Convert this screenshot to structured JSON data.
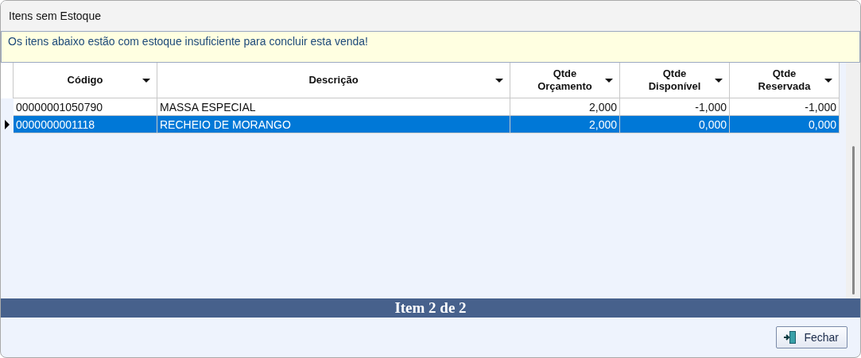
{
  "window": {
    "title": "Itens sem Estoque"
  },
  "banner": "Os itens abaixo estão com estoque insuficiente para concluir esta venda!",
  "table": {
    "columns": [
      {
        "label": "Código"
      },
      {
        "label": "Descrição"
      },
      {
        "label": "Qtde\nOrçamento"
      },
      {
        "label": "Qtde\nDisponível"
      },
      {
        "label": "Qtde\nReservada"
      }
    ],
    "rows": [
      {
        "selected": false,
        "cells": [
          "00000001050790",
          "MASSA ESPECIAL",
          "2,000",
          "-1,000",
          "-1,000"
        ]
      },
      {
        "selected": true,
        "cells": [
          "0000000001118",
          "RECHEIO DE MORANGO",
          "2,000",
          "0,000",
          "0,000"
        ]
      }
    ]
  },
  "status_bar": "Item 2 de 2",
  "buttons": [
    {
      "label": "Fechar"
    }
  ]
}
